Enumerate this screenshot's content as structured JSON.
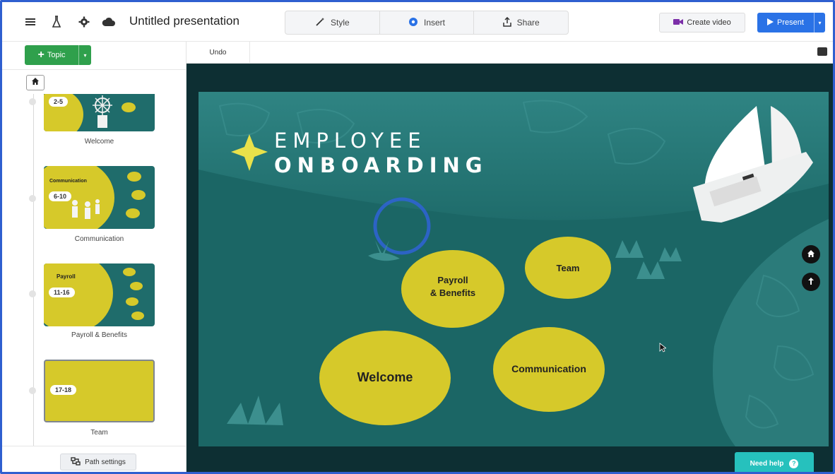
{
  "header": {
    "menu_icon": "hamburger-menu-icon",
    "title": "Untitled presentation",
    "tabs": [
      {
        "label": "Style",
        "icon": "magic-wand-icon"
      },
      {
        "label": "Insert",
        "icon": "insert-icon"
      },
      {
        "label": "Share",
        "icon": "share-upload-icon"
      }
    ],
    "create_video_label": "Create video",
    "present_label": "Present"
  },
  "sidebar": {
    "topic_label": "Topic",
    "path_settings_label": "Path settings",
    "topics": [
      {
        "range": "2-5",
        "label": "Welcome"
      },
      {
        "range": "6-10",
        "label": "Communication",
        "thumb_title": "Communication"
      },
      {
        "range": "11-16",
        "label": "Payroll & Benefits",
        "thumb_title": "Payroll"
      },
      {
        "range": "17-18",
        "label": "Team"
      }
    ]
  },
  "toolbar": {
    "undo_label": "Undo"
  },
  "slide": {
    "title_line1": "EMPLOYEE",
    "title_line2": "ONBOARDING",
    "topics": {
      "payroll_line1": "Payroll",
      "payroll_line2": "& Benefits",
      "team": "Team",
      "welcome": "Welcome",
      "communication": "Communication"
    }
  },
  "help": {
    "label": "Need help"
  },
  "colors": {
    "accent_blue": "#2a72e6",
    "topic_green": "#2fa04c",
    "teal_bg": "#1f6c6b",
    "blob_yellow": "#d6c92a",
    "help_teal": "#26c1bd"
  }
}
